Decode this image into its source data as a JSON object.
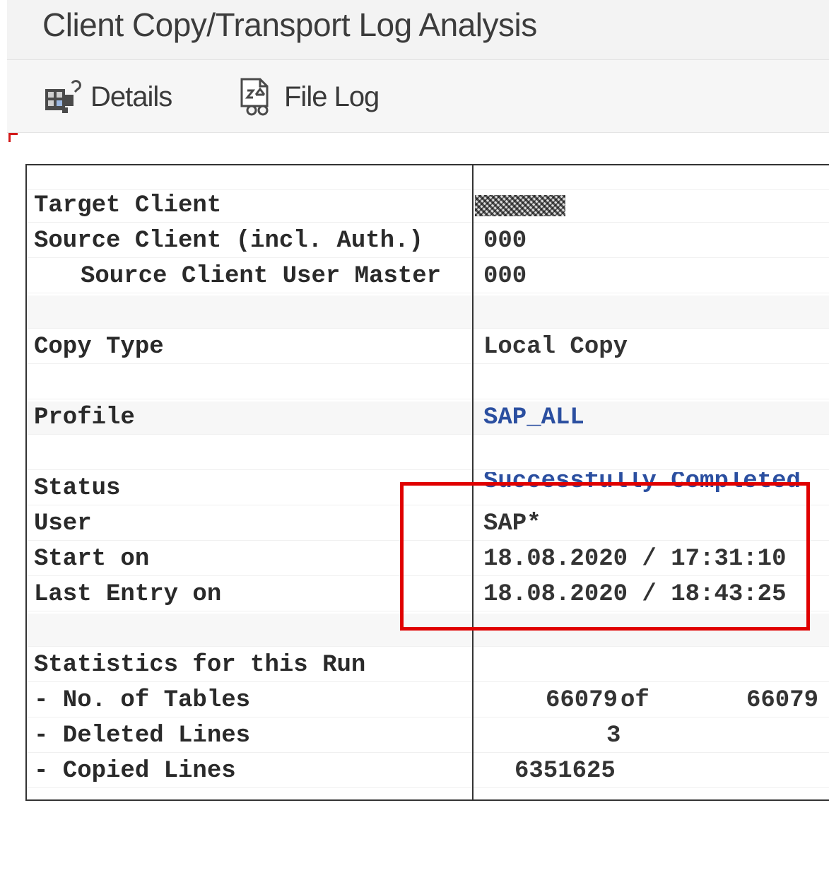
{
  "window": {
    "title": "Client Copy/Transport Log Analysis"
  },
  "toolbar": {
    "details_label": "Details",
    "file_log_label": "File Log",
    "details_icon": "details-icon",
    "file_log_icon": "file-log-icon"
  },
  "details": {
    "target_client_label": "Target Client",
    "target_client_value": "",
    "source_client_label": "Source Client (incl. Auth.)",
    "source_client_value": "000",
    "source_user_master_label": "Source Client User Master",
    "source_user_master_value": "000",
    "copy_type_label": "Copy Type",
    "copy_type_value": "Local Copy",
    "profile_label": "Profile",
    "profile_value": "SAP_ALL",
    "status_label": "Status",
    "status_value": "Successfully Completed",
    "user_label": "User",
    "user_value": "SAP*",
    "start_on_label": "Start on",
    "start_on_value": "18.08.2020 / 17:31:10",
    "last_entry_label": "Last Entry on",
    "last_entry_value": "18.08.2020 / 18:43:25"
  },
  "statistics": {
    "heading": "Statistics for this Run",
    "tables_label": "- No. of Tables",
    "tables_done": "66079",
    "tables_of": "of",
    "tables_total": "66079",
    "deleted_label": "- Deleted Lines",
    "deleted_value": "3",
    "copied_label": "- Copied Lines",
    "copied_value": "6351625"
  },
  "colors": {
    "highlight_box": "#e00000",
    "link_text": "#2b4fa0"
  }
}
